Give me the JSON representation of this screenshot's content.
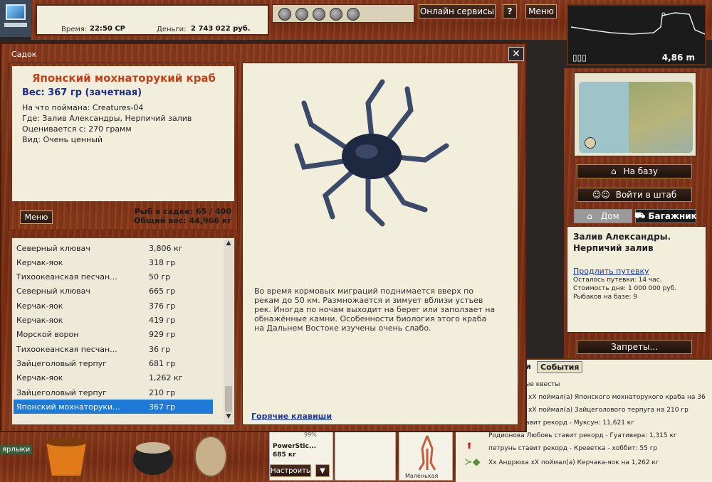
{
  "topbar": {
    "time_label": "Время:",
    "time_value": "22:50 СР",
    "money_label": "Деньги:",
    "money_value": "2 743 022 руб.",
    "online_services_label": "Онлайн сервисы",
    "help_label": "?",
    "menu_label": "Меню"
  },
  "depth": {
    "value": "4,86 m",
    "battery": "▯▯▯"
  },
  "right_panel": {
    "to_base_label": "На базу",
    "to_hq_label": "Войти в штаб",
    "home_tab_label": "Дом",
    "trunk_tab_label": "Багажник",
    "location_title": "Залив Александры. Нерпичий залив",
    "extend_trip_label": "Продлить путевку",
    "trip_left": "Осталось путевки: 14 час.",
    "day_cost": "Стоимость дня: 1 000 000 руб.",
    "anglers_on_base": "Рыбаков на базе: 9",
    "bans_label": "Запреты..."
  },
  "events": {
    "tab_left_partial": "и",
    "tab_label": "События",
    "items": [
      "вые квесты",
      "хХ поймал(а) Японского мохнаторукого краба на 36",
      "хХ поймал(а) Зайцеголового терпуга на 210 гр",
      "авит рекорд - Муксун: 11,621 кг",
      "Родионова Любовь ставит рекорд - Гуативера: 1,315 кг",
      "петрунь ставит рекорд - Креветка - хоббит: 55 гр",
      "Хх Андрюха хХ поймал(а) Керчака-яок на 1,262 кг"
    ]
  },
  "bottom": {
    "shortcuts_label": "ярлыки",
    "rod_name": "PowerStic...",
    "rod_weight": "685 кг",
    "rod_percent": "99%",
    "setup_label": "Настроить",
    "dropdown_label": "▼",
    "lure_label": "Маленькая"
  },
  "window": {
    "title": "Садок",
    "close_label": "✕",
    "fish": {
      "name": "Японский мохнаторукий краб",
      "weight": "Вес: 367 гр (зачетная)",
      "caught_on": "На что поймана: Creatures-04",
      "where": "Где: Залив Александры, Нерпичий залив",
      "valued_from": "Оценивается с: 270 грамм",
      "kind": "Вид: Очень ценный",
      "menu_label": "Меню",
      "count": "Рыб в садке: 65 / 400",
      "total_weight": "Общий вес: 44,966 кг",
      "description": "Во время кормовых миграций поднимается вверх по рекам до 50 км. Размножается и зимует вблизи устьев рек. Иногда по ночам выходит на берег или заползает на обнажённые камни. Особенности биология этого краба на Дальнем Востоке изучены очень слабо.",
      "hotkeys_label": "Горячие клавиши"
    },
    "list": [
      {
        "name": "Северный клювач",
        "weight": "3,806 кг"
      },
      {
        "name": "Керчак-яок",
        "weight": "318 гр"
      },
      {
        "name": "Тихоокеанская песчан...",
        "weight": "50 гр"
      },
      {
        "name": "Северный клювач",
        "weight": "665 гр"
      },
      {
        "name": "Керчак-яок",
        "weight": "376 гр"
      },
      {
        "name": "Керчак-яок",
        "weight": "419 гр"
      },
      {
        "name": "Морской ворон",
        "weight": "929 гр"
      },
      {
        "name": "Тихоокеанская песчан...",
        "weight": "36 гр"
      },
      {
        "name": "Зайцеголовый терпуг",
        "weight": "681 гр"
      },
      {
        "name": "Керчак-яок",
        "weight": "1,262 кг"
      },
      {
        "name": "Зайцеголовый терпуг",
        "weight": "210 гр"
      },
      {
        "name": "Японский мохнаторуки...",
        "weight": "367 гр"
      }
    ]
  }
}
